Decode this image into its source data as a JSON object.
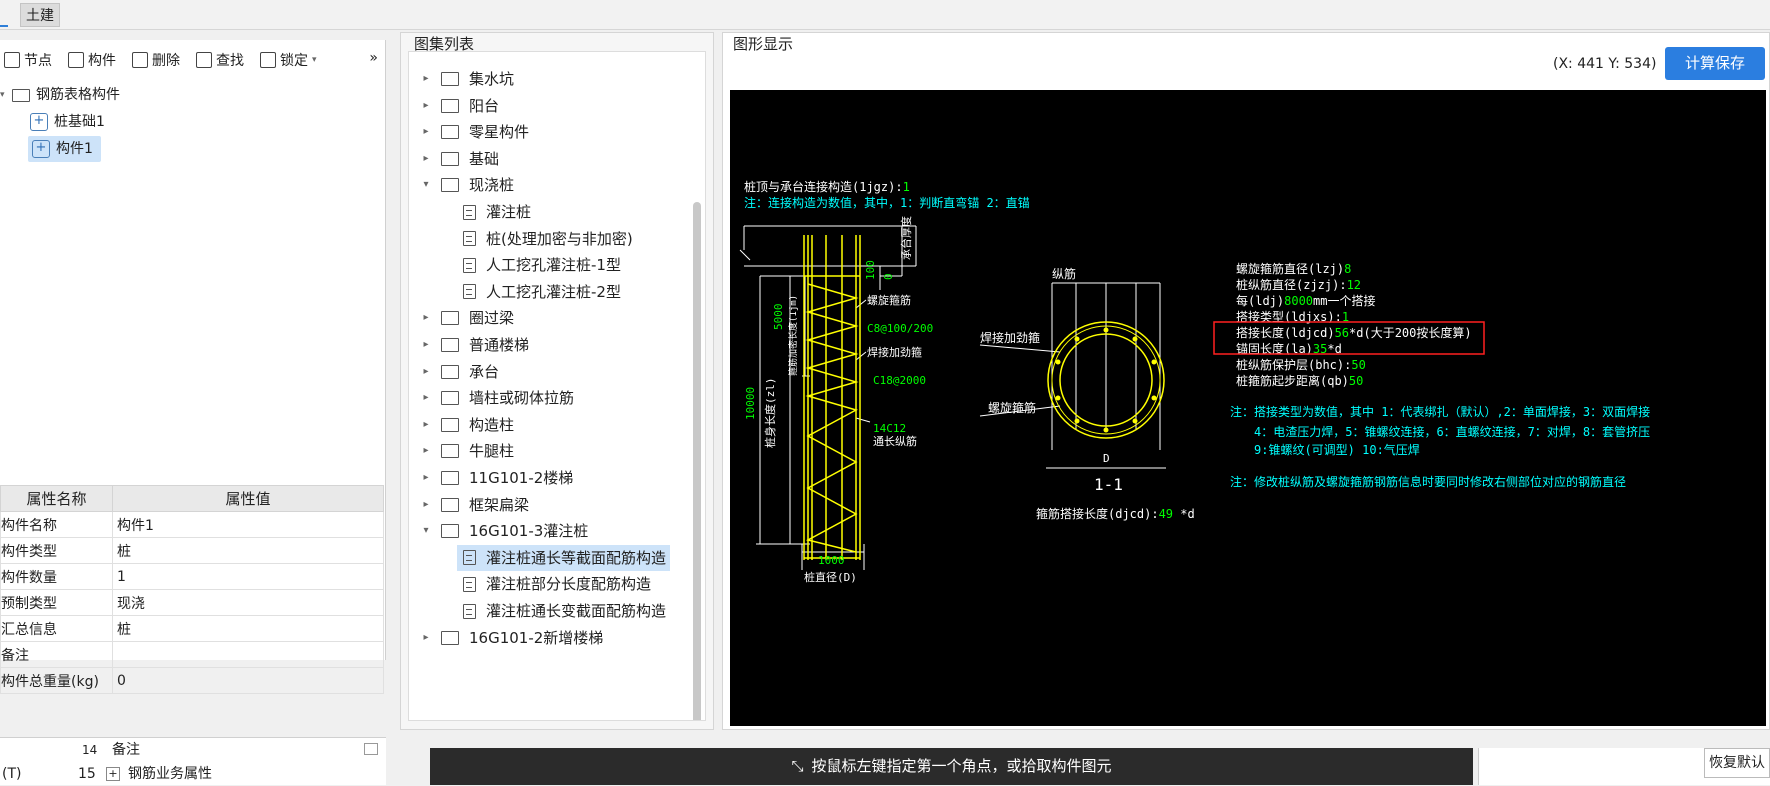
{
  "tabs": {
    "first": "",
    "second": "土建"
  },
  "toolbar": {
    "node": "节点",
    "component": "构件",
    "delete": "删除",
    "find": "查找",
    "lock": "锁定",
    "more": "»"
  },
  "tree": {
    "root": "钢筋表格构件",
    "items": [
      "桩基础1",
      "构件1"
    ]
  },
  "props": {
    "head_name": "属性名称",
    "head_value": "属性值",
    "rows": [
      {
        "k": "构件名称",
        "v": "构件1"
      },
      {
        "k": "构件类型",
        "v": "桩"
      },
      {
        "k": "构件数量",
        "v": "1"
      },
      {
        "k": "预制类型",
        "v": "现浇"
      },
      {
        "k": "汇总信息",
        "v": "桩"
      },
      {
        "k": "备注",
        "v": ""
      },
      {
        "k": "构件总重量(kg)",
        "v": "0"
      }
    ]
  },
  "bottom_left": {
    "row1_num": "14",
    "row1_label": "备注",
    "row2_prefix": "(T)",
    "row2_num": "15",
    "row2_label": "钢筋业务属性"
  },
  "atlas": {
    "title": "图集列表",
    "items": [
      {
        "label": "集水坑",
        "type": "folder",
        "expanded": false
      },
      {
        "label": "阳台",
        "type": "folder",
        "expanded": false
      },
      {
        "label": "零星构件",
        "type": "folder",
        "expanded": false
      },
      {
        "label": "基础",
        "type": "folder",
        "expanded": false
      },
      {
        "label": "现浇桩",
        "type": "folder",
        "expanded": true
      },
      {
        "label": "灌注桩",
        "type": "doc"
      },
      {
        "label": "桩(处理加密与非加密)",
        "type": "doc"
      },
      {
        "label": "人工挖孔灌注桩-1型",
        "type": "doc"
      },
      {
        "label": "人工挖孔灌注桩-2型",
        "type": "doc"
      },
      {
        "label": "圈过梁",
        "type": "folder",
        "expanded": false
      },
      {
        "label": "普通楼梯",
        "type": "folder",
        "expanded": false
      },
      {
        "label": "承台",
        "type": "folder",
        "expanded": false
      },
      {
        "label": "墙柱或砌体拉筋",
        "type": "folder",
        "expanded": false
      },
      {
        "label": "构造柱",
        "type": "folder",
        "expanded": false
      },
      {
        "label": "牛腿柱",
        "type": "folder",
        "expanded": false
      },
      {
        "label": "11G101-2楼梯",
        "type": "folder",
        "expanded": false
      },
      {
        "label": "框架扁梁",
        "type": "folder",
        "expanded": false
      },
      {
        "label": "16G101-3灌注桩",
        "type": "folder",
        "expanded": true
      },
      {
        "label": "灌注桩通长等截面配筋构造",
        "type": "doc",
        "selected": true
      },
      {
        "label": "灌注桩部分长度配筋构造",
        "type": "doc"
      },
      {
        "label": "灌注桩通长变截面配筋构造",
        "type": "doc"
      },
      {
        "label": "16G101-2新增楼梯",
        "type": "folder",
        "expanded": false
      }
    ]
  },
  "graphic": {
    "title": "图形显示",
    "coords": "(X: 441 Y: 534)",
    "calc_button": "计算保存",
    "top1_a": "桩顶与承台连接构造(1jgz):",
    "top1_b": "1",
    "top2": "注：连接构造为数值，其中，1：判断直弯锚     2：直锚",
    "lbl_cap": "承台厚度",
    "lbl_zero": "0",
    "lbl_100": "100",
    "lbl_5000": "5000",
    "lbl_dense": "箍筋加密长度(1jm)",
    "lbl_10000": "10000",
    "lbl_pilelen": "桩身长度(zl)",
    "lbl_spiral": "螺旋箍筋",
    "lbl_spiral_spec": "C8@100/200",
    "lbl_weld": "焊接加劲箍",
    "lbl_weld_spec": "C18@2000",
    "lbl_14c12": "14C12",
    "lbl_long": "通长纵筋",
    "lbl_1000": "1000",
    "lbl_dia": "桩直径(D)",
    "sec_long": "纵筋",
    "sec_weld": "焊接加劲箍",
    "sec_spiral": "螺旋箍筋",
    "sec_d": "D",
    "sec_title": "1-1",
    "sec_bottom_a": "箍筋搭接长度(djcd):",
    "sec_bottom_b": "49",
    "sec_bottom_c": " *d",
    "info": [
      {
        "a": "螺旋箍筋直径(lzj)",
        "b": "8",
        "c": ""
      },
      {
        "a": "桩纵筋直径(zjzj):",
        "b": "12",
        "c": ""
      },
      {
        "a": "每(ldj)",
        "b": "8000",
        "c": "mm一个搭接"
      },
      {
        "a": "搭接类型(ldjxs):",
        "b": "1",
        "c": ""
      },
      {
        "a": "搭接长度(ldjcd)",
        "b": "56",
        "c": "*d(大于200按长度算)"
      },
      {
        "a": "锚固长度(la)",
        "b": "35",
        "c": "*d"
      },
      {
        "a": "桩纵筋保护层(bhc):",
        "b": "50",
        "c": ""
      },
      {
        "a": "桩箍筋起步距离(qb)",
        "b": "50",
        "c": ""
      }
    ],
    "note1": "注：搭接类型为数值，其中 1：代表绑扎（默认）,2：单面焊接，3：双面焊接",
    "note2": "4：电渣压力焊，5：锥螺纹连接，6：直螺纹连接，7：对焊，8：套管挤压",
    "note3": "9:锥螺纹(可调型)  10:气压焊",
    "note4": "注：修改桩纵筋及螺旋箍筋钢筋信息时要同时修改右侧部位对应的钢筋直径"
  },
  "status": {
    "hint": "按鼠标左键指定第一个角点，或拾取构件图元",
    "restore": "恢复默认"
  },
  "colors": {
    "accent": "#2b7ee0",
    "cad_white": "#ffffff",
    "cad_green": "#00ff00",
    "cad_yellow": "#ffff00",
    "cad_cyan": "#00ffff",
    "highlight_red": "#ff2020"
  }
}
